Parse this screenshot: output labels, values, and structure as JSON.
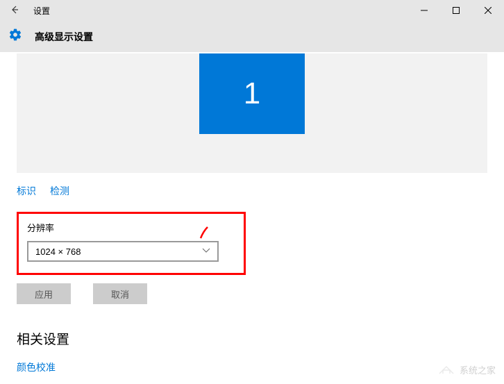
{
  "titlebar": {
    "title": "设置"
  },
  "header": {
    "title": "高级显示设置"
  },
  "monitor": {
    "number": "1"
  },
  "links": {
    "identify": "标识",
    "detect": "检测"
  },
  "resolution": {
    "label": "分辨率",
    "value": "1024 × 768"
  },
  "buttons": {
    "apply": "应用",
    "cancel": "取消"
  },
  "related": {
    "title": "相关设置",
    "color_calibration": "颜色校准"
  },
  "watermark": {
    "text": "系统之家"
  }
}
